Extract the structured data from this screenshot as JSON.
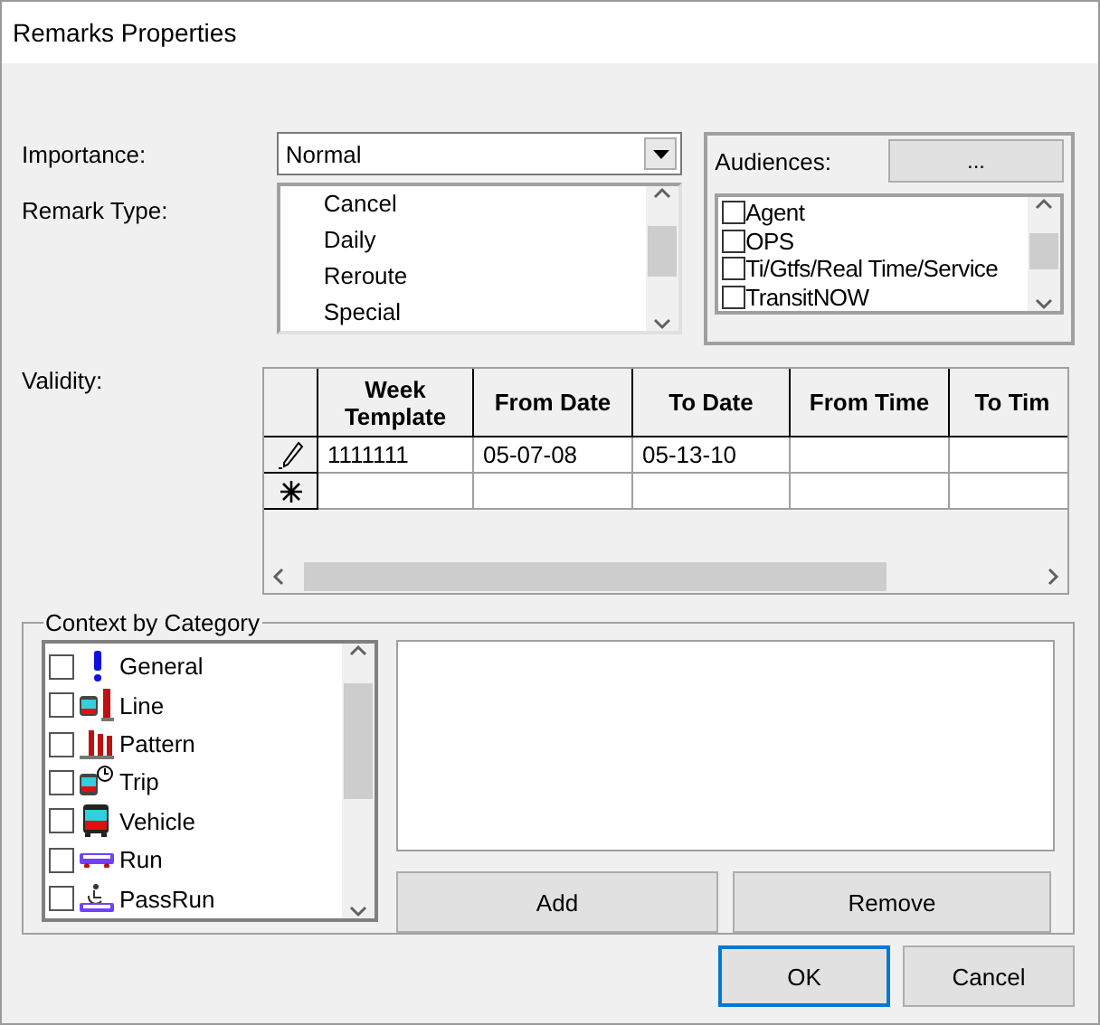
{
  "window": {
    "title": "Remarks Properties"
  },
  "importance": {
    "label": "Importance:",
    "value": "Normal"
  },
  "remark_type": {
    "label": "Remark Type:",
    "items": [
      {
        "label": "Cancel",
        "selected": false
      },
      {
        "label": "Daily",
        "selected": false
      },
      {
        "label": "Reroute",
        "selected": false
      },
      {
        "label": "Special",
        "selected": false
      }
    ]
  },
  "audiences": {
    "label": "Audiences:",
    "button": "...",
    "items": [
      {
        "label": "Agent",
        "checked": false
      },
      {
        "label": "OPS",
        "checked": false
      },
      {
        "label": "Ti/Gtfs/Real Time/Service",
        "checked": false
      },
      {
        "label": "TransitNOW",
        "checked": false
      }
    ]
  },
  "validity": {
    "label": "Validity:",
    "columns": [
      "Week Template",
      "From Date",
      "To Date",
      "From Time",
      "To Tim"
    ],
    "rows": [
      {
        "kind": "edit",
        "cells": [
          "1111111",
          "05-07-08",
          "05-13-10",
          "",
          ""
        ]
      },
      {
        "kind": "new",
        "cells": [
          "",
          "",
          "",
          "",
          ""
        ]
      }
    ]
  },
  "context": {
    "label": "Context by Category",
    "items": [
      {
        "label": "General",
        "kind": "general",
        "checked": false
      },
      {
        "label": "Line",
        "kind": "line",
        "checked": false
      },
      {
        "label": "Pattern",
        "kind": "pattern",
        "checked": false
      },
      {
        "label": "Trip",
        "kind": "trip",
        "checked": false
      },
      {
        "label": "Vehicle",
        "kind": "vehicle",
        "checked": false
      },
      {
        "label": "Run",
        "kind": "run",
        "checked": false
      },
      {
        "label": "PassRun",
        "kind": "passrun",
        "checked": false
      }
    ],
    "add": "Add",
    "remove": "Remove"
  },
  "buttons": [
    "OK",
    "Cancel"
  ]
}
